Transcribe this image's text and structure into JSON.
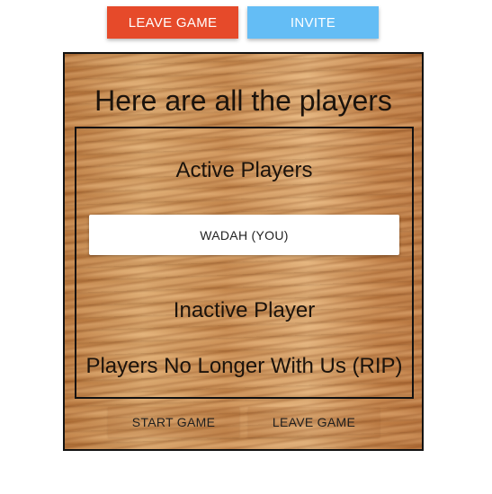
{
  "header": {
    "leave_game_label": "LEAVE GAME",
    "invite_label": "INVITE"
  },
  "board": {
    "title": "Here are all the players",
    "active_section_title": "Active Players",
    "active_players": [
      "WADAH (YOU)"
    ],
    "inactive_section_title": "Inactive Player",
    "rip_section_title": "Players No Longer With Us (RIP)",
    "start_game_label": "START GAME",
    "leave_game_label": "LEAVE GAME"
  },
  "colors": {
    "leave_button": "#e64a2a",
    "invite_button": "#64bdf5",
    "board_border": "#111111",
    "wood_base": "#c98a4e"
  }
}
